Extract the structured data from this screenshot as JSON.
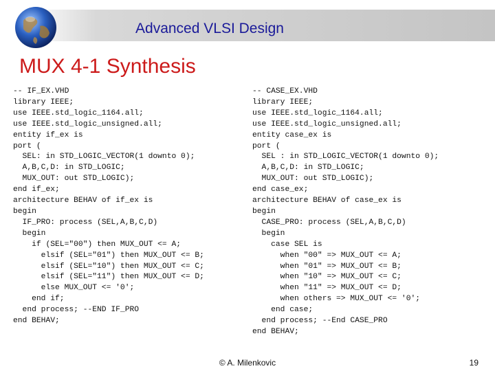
{
  "header": {
    "title": "Advanced VLSI Design"
  },
  "slide": {
    "title": "MUX 4-1 Synthesis"
  },
  "code_left": [
    "-- IF_EX.VHD",
    "library IEEE;",
    "use IEEE.std_logic_1164.all;",
    "use IEEE.std_logic_unsigned.all;",
    "entity if_ex is",
    "port (",
    "  SEL: in STD_LOGIC_VECTOR(1 downto 0);",
    "  A,B,C,D: in STD_LOGIC;",
    "  MUX_OUT: out STD_LOGIC);",
    "end if_ex;",
    "architecture BEHAV of if_ex is",
    "begin",
    "  IF_PRO: process (SEL,A,B,C,D)",
    "  begin",
    "    if (SEL=\"00\") then MUX_OUT <= A;",
    "      elsif (SEL=\"01\") then MUX_OUT <= B;",
    "      elsif (SEL=\"10\") then MUX_OUT <= C;",
    "      elsif (SEL=\"11\") then MUX_OUT <= D;",
    "      else MUX_OUT <= '0';",
    "    end if;",
    "  end process; --END IF_PRO",
    "end BEHAV;"
  ],
  "code_right": [
    "-- CASE_EX.VHD",
    "library IEEE;",
    "use IEEE.std_logic_1164.all;",
    "use IEEE.std_logic_unsigned.all;",
    "entity case_ex is",
    "port (",
    "  SEL : in STD_LOGIC_VECTOR(1 downto 0);",
    "  A,B,C,D: in STD_LOGIC;",
    "  MUX_OUT: out STD_LOGIC);",
    "end case_ex;",
    "architecture BEHAV of case_ex is",
    "begin",
    "  CASE_PRO: process (SEL,A,B,C,D)",
    "  begin",
    "    case SEL is",
    "      when \"00\" => MUX_OUT <= A;",
    "      when \"01\" => MUX_OUT <= B;",
    "      when \"10\" => MUX_OUT <= C;",
    "      when \"11\" => MUX_OUT <= D;",
    "      when others => MUX_OUT <= '0';",
    "    end case;",
    "  end process; --End CASE_PRO",
    "end BEHAV;"
  ],
  "footer": {
    "author": "© A. Milenkovic",
    "page": "19"
  },
  "colors": {
    "title_red": "#cc1a1a",
    "header_blue": "#1a1a99"
  }
}
